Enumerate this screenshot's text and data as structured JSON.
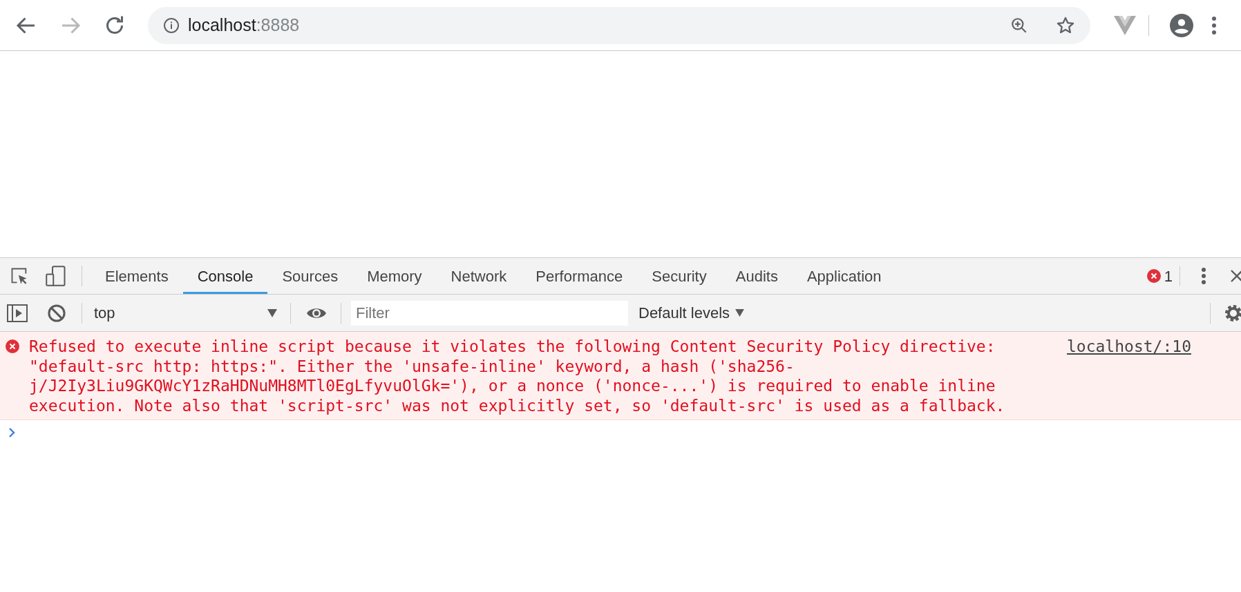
{
  "browser": {
    "nav_buttons": [
      {
        "kind": "back",
        "disabled": false
      },
      {
        "kind": "forward",
        "disabled": true
      },
      {
        "kind": "reload",
        "disabled": false
      }
    ],
    "address": {
      "host": "localhost",
      "port": ":8888"
    }
  },
  "devtools": {
    "tabs": [
      {
        "label": "Elements",
        "selected": false
      },
      {
        "label": "Console",
        "selected": true
      },
      {
        "label": "Sources",
        "selected": false
      },
      {
        "label": "Memory",
        "selected": false
      },
      {
        "label": "Network",
        "selected": false
      },
      {
        "label": "Performance",
        "selected": false
      },
      {
        "label": "Security",
        "selected": false
      },
      {
        "label": "Audits",
        "selected": false
      },
      {
        "label": "Application",
        "selected": false
      }
    ],
    "error_count": "1",
    "console_toolbar": {
      "context": "top",
      "filter": {
        "placeholder": "Filter"
      },
      "levels": "Default levels"
    },
    "messages": [
      {
        "kind": "error",
        "text": "Refused to execute inline script because it violates the following Content Security Policy directive: \"default-src http: https:\". Either the 'unsafe-inline' keyword, a hash ('sha256-j/J2Iy3Liu9GKQWcY1zRaHDNuMH8MTl0EgLfyvuOlGk='), or a nonce ('nonce-...') is required to enable inline execution. Note also that 'script-src' was not explicitly set, so 'default-src' is used as a fallback.",
        "source": "localhost/:10"
      }
    ]
  }
}
